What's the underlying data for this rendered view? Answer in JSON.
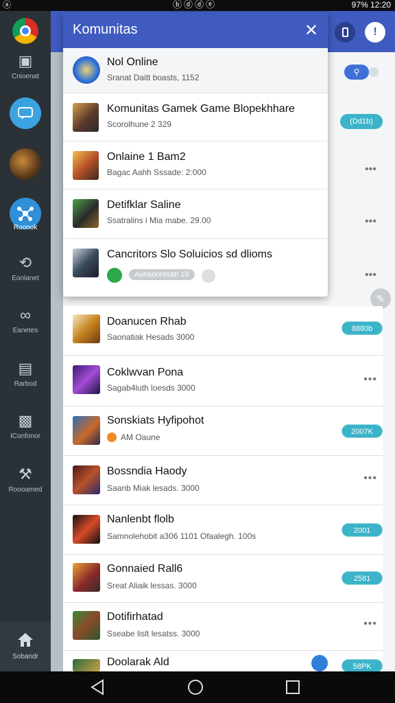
{
  "status_bar": {
    "left": "ⓐ",
    "middle": "ⓑⓓⓓⓔ",
    "right": "97% 12:20"
  },
  "rail": {
    "items": [
      {
        "label": "Cnioenat"
      },
      {
        "label": ""
      },
      {
        "label": ""
      },
      {
        "label": "Roonok"
      },
      {
        "label": "Eonlanet"
      },
      {
        "label": "Eanetes"
      },
      {
        "label": "Rarbod"
      },
      {
        "label": "IConfonor"
      },
      {
        "label": "Roooamed"
      }
    ],
    "home_label": "Sobandr"
  },
  "panel": {
    "title": "Komunitas",
    "items": [
      {
        "title": "Nol Online",
        "sub": "Sranat Daitt boasts, 1152"
      },
      {
        "title": "Komunitas Gamek Game Blopekhhare",
        "sub": "Scorolhune 2 329"
      },
      {
        "title": "Onlaine 1 Bam2",
        "sub": "Bagac Aahh Sssade: 2:000"
      },
      {
        "title": "Detifklar Saline",
        "sub": "Ssatralins i Mia mabe. 29.00"
      },
      {
        "title": "Cancritors Slo Soluicios sd dlioms",
        "sub": "Aunsonntsan 19"
      }
    ]
  },
  "list": {
    "items": [
      {
        "title": "Doanucen Rhab",
        "sub": "Saonatiak Hesads 3000",
        "badge": "8880b"
      },
      {
        "title": "Coklwvan Pona",
        "sub": "Sagab4luth loesds 3000",
        "badge": ""
      },
      {
        "title": "Sonskiats Hyfipohot",
        "sub": "AM Oaune",
        "badge": "2007K"
      },
      {
        "title": "Bossndia Haody",
        "sub": "Saanb Miak lesads. 3000",
        "badge": ""
      },
      {
        "title": "Nanlenbt flolb",
        "sub": "Samnolehobit a306 1101 Ofaalegh. 100s",
        "badge": "2001"
      },
      {
        "title": "Gonnaied Rall6",
        "sub": "Sreat Aliaik lessas. 3000",
        "badge": "2581"
      },
      {
        "title": "Dotifirhatad",
        "sub": "Sseabe lislt lesatss. 3000",
        "badge": ""
      },
      {
        "title": "Doolarak Ald",
        "sub": "",
        "badge": "58PK"
      }
    ],
    "top_badge": "(Dd1b)"
  }
}
